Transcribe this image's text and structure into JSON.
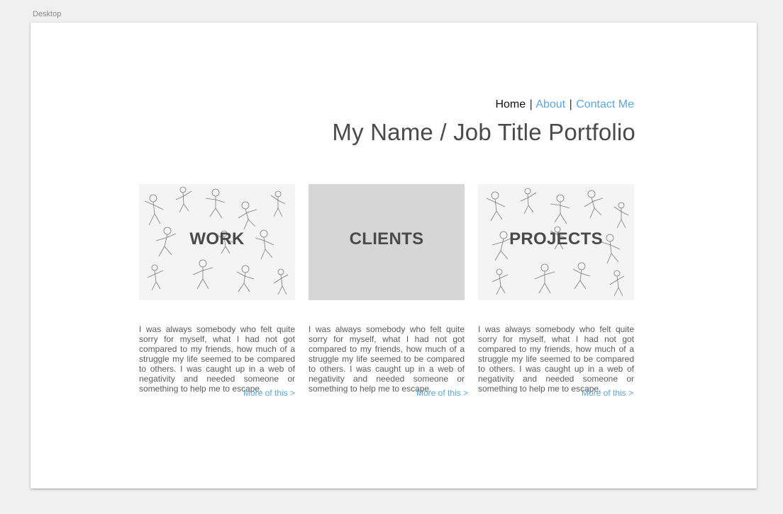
{
  "canvas": {
    "label": "Desktop"
  },
  "nav": {
    "home": "Home",
    "separator": "|",
    "about": "About",
    "contact": "Contact Me"
  },
  "header": {
    "title": "My Name / Job Title Portfolio"
  },
  "cards": [
    {
      "title": "WORK",
      "background": "sketch",
      "description": "I was always somebody who felt quite sorry for myself, what I had not got compared to my friends, how much of a struggle my life seemed to be compared to others. I was caught up in a web of negativity and needed someone or something to help me to escape.",
      "more": "More of this >"
    },
    {
      "title": "CLIENTS",
      "background": "plain-gray",
      "description": "I was always somebody who felt quite sorry for myself, what I had not got compared to my friends, how much of a struggle my life seemed to be compared to others. I was caught up in a web of negativity and needed someone or something to help me to escape.",
      "more": "More of this >"
    },
    {
      "title": "PROJECTS",
      "background": "sketch",
      "description": "I was always somebody who felt quite sorry for myself, what I had not got compared to my friends, how much of a struggle my life seemed to be compared to others. I was caught up in a web of negativity and needed someone or something to help me to escape.",
      "more": "More of this >"
    }
  ],
  "colors": {
    "link": "#5aa6e0",
    "title_text": "#4a4a4a",
    "body_text": "#5a5a5a",
    "tile_gray": "#d6d6d6",
    "canvas_bg": "#f0f0f0"
  }
}
